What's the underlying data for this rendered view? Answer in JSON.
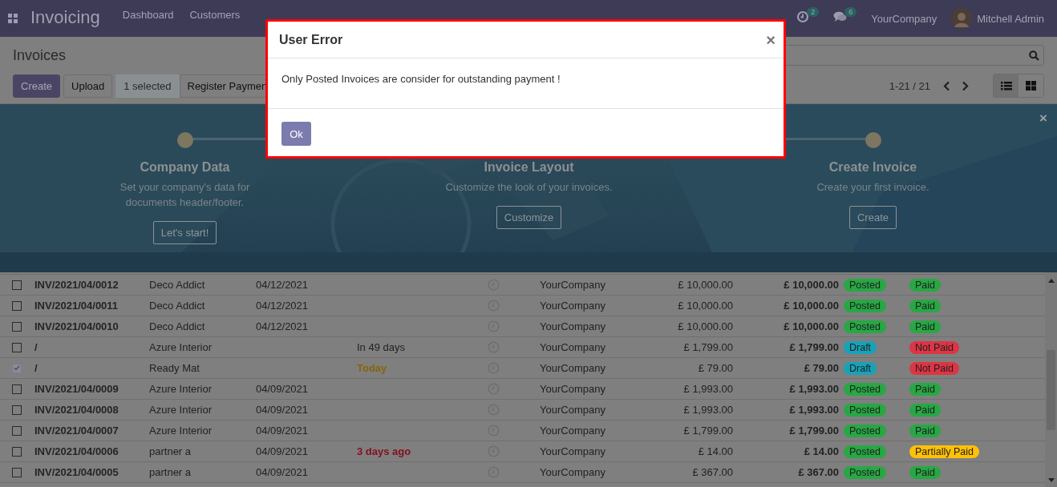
{
  "navbar": {
    "app_name": "Invoicing",
    "menu": [
      "Dashboard",
      "Customers"
    ],
    "activity_count": "2",
    "message_count": "6",
    "company": "YourCompany",
    "user": "Mitchell Admin"
  },
  "control_panel": {
    "title": "Invoices",
    "buttons": [
      {
        "label": "Create",
        "kind": "primary"
      },
      {
        "label": "Upload",
        "kind": "secondary"
      },
      {
        "label": "1 selected",
        "kind": "info"
      },
      {
        "label": "Register Paymen",
        "kind": "secondary"
      }
    ],
    "pager": "1-21 / 21",
    "views": [
      {
        "kind": "list",
        "selected": true
      },
      {
        "kind": "kanban",
        "selected": false
      }
    ]
  },
  "banner": {
    "steps": [
      {
        "title": "Company Data",
        "description": "Set your company's data for\ndocuments header/footer.",
        "button": "Let's start!"
      },
      {
        "title": "Invoice Layout",
        "description": "Customize the look of your invoices.",
        "button": "Customize"
      },
      {
        "title": "Create Invoice",
        "description": "Create your first invoice.",
        "button": "Create"
      }
    ],
    "close": "×"
  },
  "table": {
    "rows": [
      {
        "selected": false,
        "number": "INV/2021/04/0012",
        "customer": "Deco Addict",
        "date": "04/12/2021",
        "company": "YourCompany",
        "untaxed": "£ 10,000.00",
        "total": "£ 10,000.00",
        "status": {
          "text": "Posted",
          "color": "#28a745"
        },
        "payment": {
          "text": "Paid",
          "color": "#28a745"
        }
      },
      {
        "selected": false,
        "number": "INV/2021/04/0011",
        "customer": "Deco Addict",
        "date": "04/12/2021",
        "company": "YourCompany",
        "untaxed": "£ 10,000.00",
        "total": "£ 10,000.00",
        "status": {
          "text": "Posted",
          "color": "#28a745"
        },
        "payment": {
          "text": "Paid",
          "color": "#28a745"
        }
      },
      {
        "selected": false,
        "number": "INV/2021/04/0010",
        "customer": "Deco Addict",
        "date": "04/12/2021",
        "company": "YourCompany",
        "untaxed": "£ 10,000.00",
        "total": "£ 10,000.00",
        "status": {
          "text": "Posted",
          "color": "#28a745"
        },
        "payment": {
          "text": "Paid",
          "color": "#28a745"
        }
      },
      {
        "selected": false,
        "number": "/",
        "customer": "Azure Interior",
        "due": {
          "text": "In 49 days",
          "kind": "future"
        },
        "company": "YourCompany",
        "untaxed": "£ 1,799.00",
        "total": "£ 1,799.00",
        "status": {
          "text": "Draft",
          "color": "#17a2b8"
        },
        "payment": {
          "text": "Not Paid",
          "color": "#dc3545"
        }
      },
      {
        "selected": true,
        "number": "/",
        "customer": "Ready Mat",
        "due": {
          "text": "Today",
          "kind": "today"
        },
        "company": "YourCompany",
        "untaxed": "£ 79.00",
        "total": "£ 79.00",
        "status": {
          "text": "Draft",
          "color": "#17a2b8"
        },
        "payment": {
          "text": "Not Paid",
          "color": "#dc3545"
        }
      },
      {
        "selected": false,
        "number": "INV/2021/04/0009",
        "customer": "Azure Interior",
        "date": "04/09/2021",
        "company": "YourCompany",
        "untaxed": "£ 1,993.00",
        "total": "£ 1,993.00",
        "status": {
          "text": "Posted",
          "color": "#28a745"
        },
        "payment": {
          "text": "Paid",
          "color": "#28a745"
        }
      },
      {
        "selected": false,
        "number": "INV/2021/04/0008",
        "customer": "Azure Interior",
        "date": "04/09/2021",
        "company": "YourCompany",
        "untaxed": "£ 1,993.00",
        "total": "£ 1,993.00",
        "status": {
          "text": "Posted",
          "color": "#28a745"
        },
        "payment": {
          "text": "Paid",
          "color": "#28a745"
        }
      },
      {
        "selected": false,
        "number": "INV/2021/04/0007",
        "customer": "Azure Interior",
        "date": "04/09/2021",
        "company": "YourCompany",
        "untaxed": "£ 1,799.00",
        "total": "£ 1,799.00",
        "status": {
          "text": "Posted",
          "color": "#28a745"
        },
        "payment": {
          "text": "Paid",
          "color": "#28a745"
        }
      },
      {
        "selected": false,
        "number": "INV/2021/04/0006",
        "customer": "partner a",
        "date": "04/09/2021",
        "due": {
          "text": "3 days ago",
          "kind": "overdue"
        },
        "company": "YourCompany",
        "untaxed": "£ 14.00",
        "total": "£ 14.00",
        "status": {
          "text": "Posted",
          "color": "#28a745"
        },
        "payment": {
          "text": "Partially Paid",
          "color": "#ffc107"
        }
      },
      {
        "selected": false,
        "number": "INV/2021/04/0005",
        "customer": "partner a",
        "date": "04/09/2021",
        "company": "YourCompany",
        "untaxed": "£ 367.00",
        "total": "£ 367.00",
        "status": {
          "text": "Posted",
          "color": "#28a745"
        },
        "payment": {
          "text": "Paid",
          "color": "#28a745"
        }
      }
    ]
  },
  "dialog": {
    "title": "User Error",
    "close": "×",
    "message": "Only Posted Invoices are consider for outstanding payment !",
    "button": "Ok"
  }
}
